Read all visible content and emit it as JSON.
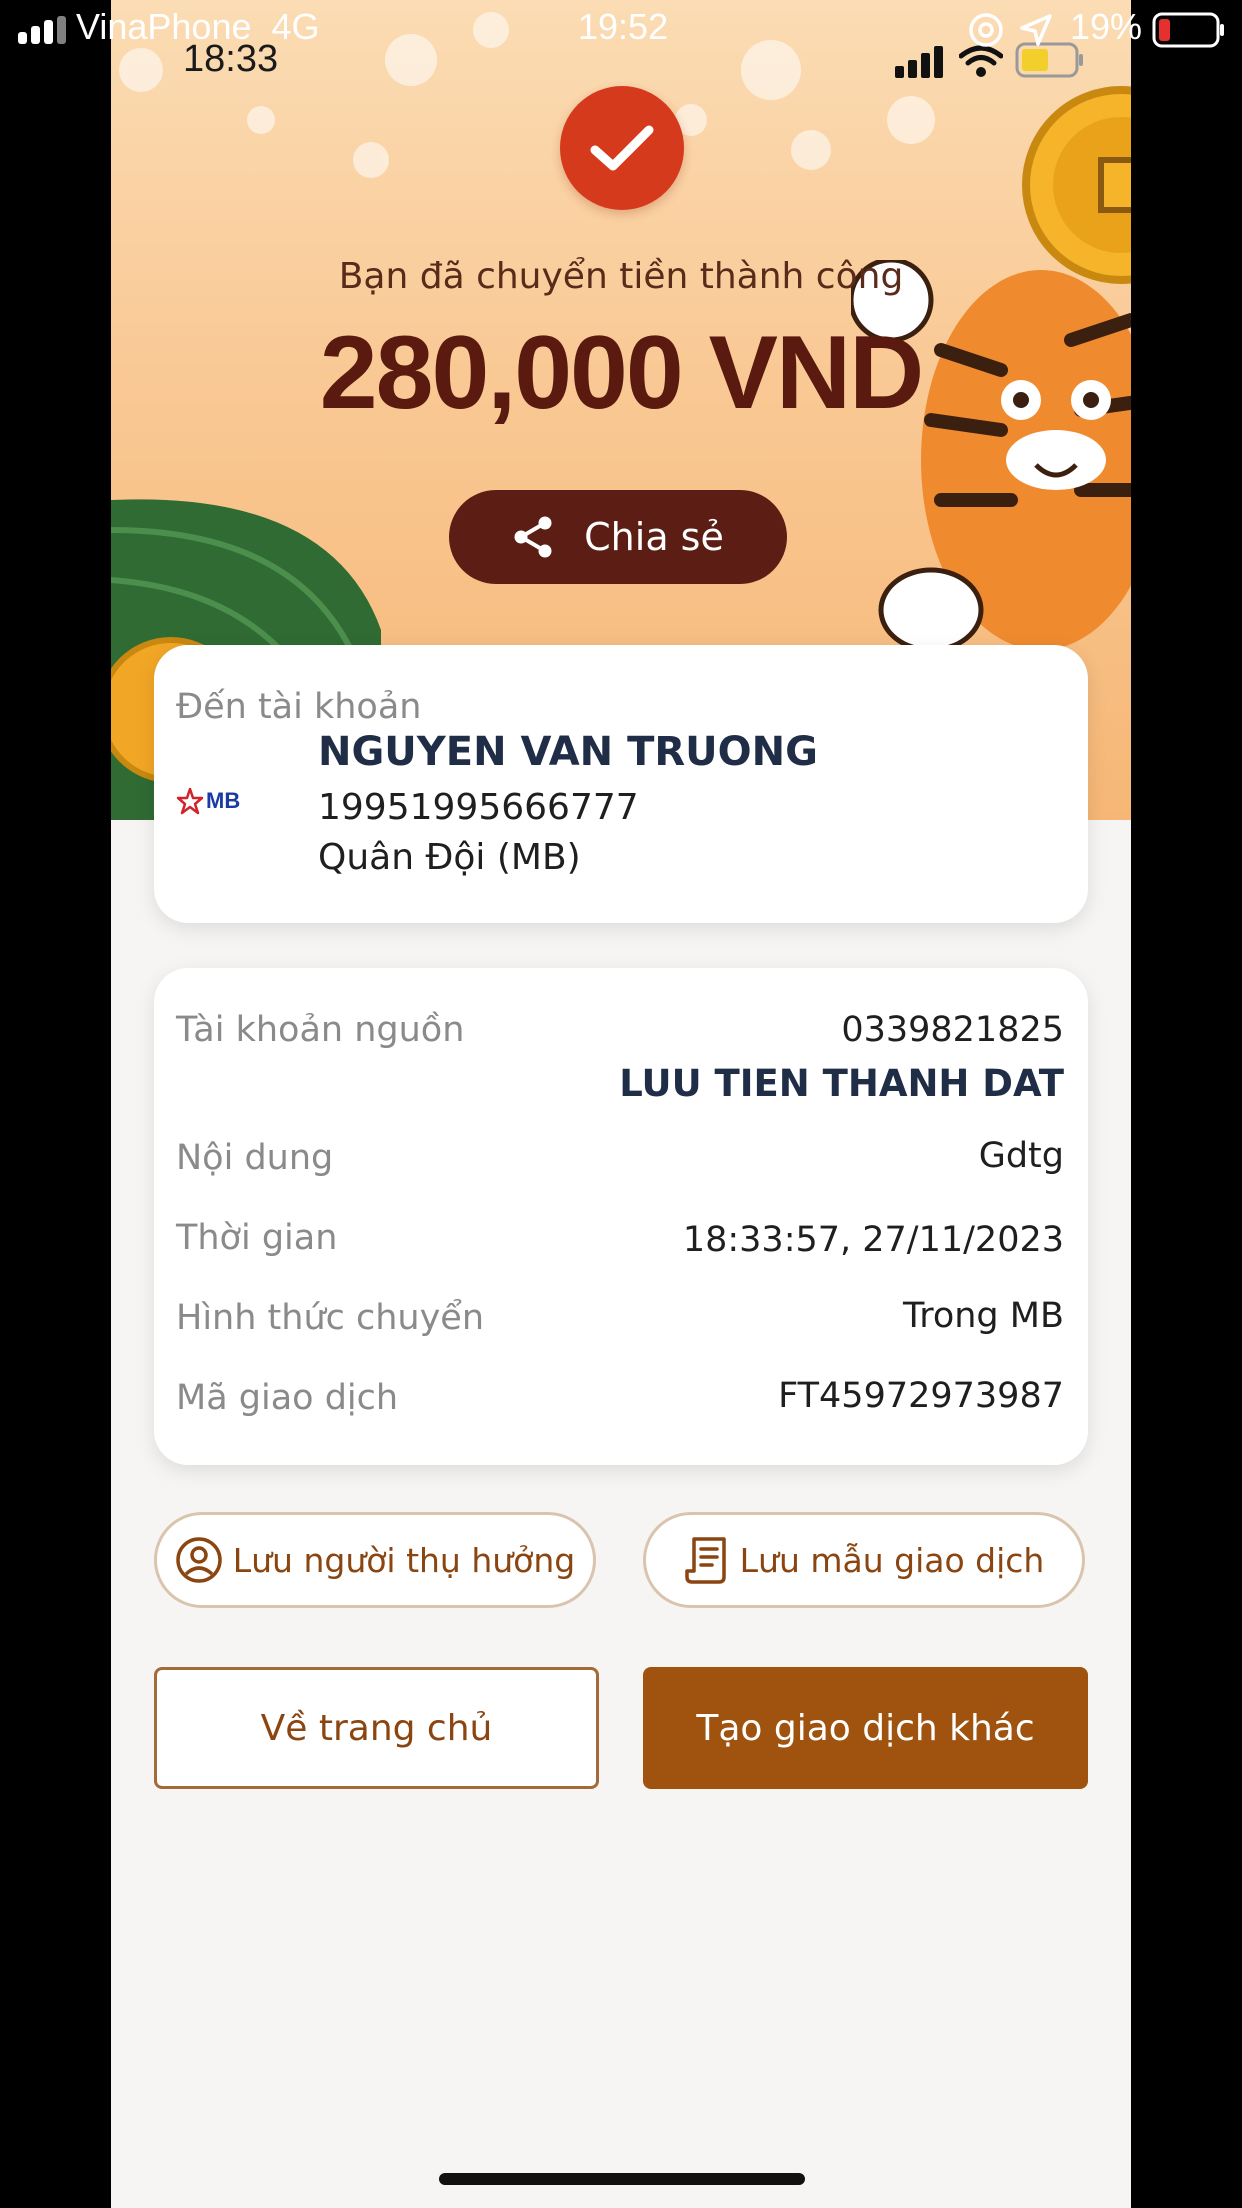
{
  "outer_status": {
    "carrier": "VinaPhone",
    "network": "4G",
    "time": "19:52",
    "battery_percent": "19%",
    "icons": [
      "signal-icon",
      "at-icon",
      "location-arrow-icon",
      "battery-low-icon"
    ],
    "battery_level": 0.19
  },
  "inner_status": {
    "time": "18:33",
    "icons": [
      "cellular-icon",
      "wifi-icon",
      "battery-icon"
    ]
  },
  "result": {
    "message": "Bạn đã chuyển tiền thành công",
    "amount": "280,000 VND",
    "share_label": "Chia sẻ",
    "share_icon": "share-icon",
    "status_icon": "checkmark-icon"
  },
  "recipient": {
    "label": "Đến tài khoản",
    "name": "NGUYEN VAN TRUONG",
    "account": "19951995666777",
    "bank": "Quân Đội (MB)",
    "bank_logo_text": "MB"
  },
  "details": {
    "source_label": "Tài khoản nguồn",
    "source_account": "0339821825",
    "source_name": "LUU TIEN THANH DAT",
    "content_label": "Nội dung",
    "content_value": "Gdtg",
    "time_label": "Thời gian",
    "time_value": "18:33:57, 27/11/2023",
    "method_label": "Hình thức chuyển",
    "method_value": "Trong MB",
    "code_label": "Mã giao dịch",
    "code_value": "FT45972973987"
  },
  "actions": {
    "save_beneficiary": "Lưu người thụ hưởng",
    "save_template": "Lưu mẫu giao dịch",
    "home": "Về trang chủ",
    "new_transaction": "Tạo giao dịch khác"
  },
  "colors": {
    "accent": "#a0520f",
    "share_button": "#5c1d14",
    "check": "#d63a1d",
    "amount_text": "#5a1a10"
  }
}
